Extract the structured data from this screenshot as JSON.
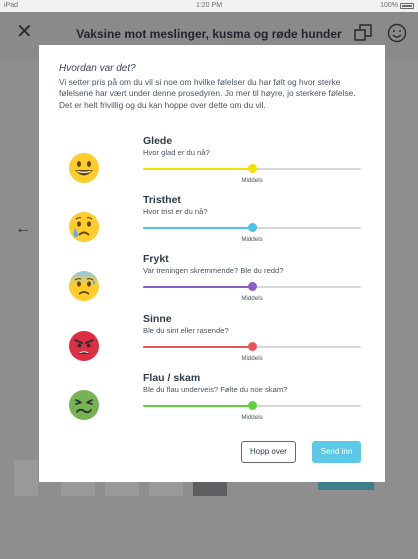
{
  "status_bar": {
    "device": "iPad",
    "time": "1:20 PM",
    "battery": "100%"
  },
  "app": {
    "title": "Vaksine mot meslinger, kusma og røde hunder"
  },
  "modal": {
    "title": "Hvordan var det?",
    "description": "Vi setter pris på om du vil si noe om hvilke følelser du har følt og hvor sterke følelsene har vært under denne prosedyren. Jo mer til høyre, jo sterkere følelse. Det er helt frivillig og du kan hoppe over dette om du vil.",
    "emotions": [
      {
        "name": "Glede",
        "question": "Hvor glad er du nå?",
        "level_label": "Middels",
        "level": 0.5,
        "color": "#f5e100",
        "icon": "grinning-face-icon"
      },
      {
        "name": "Tristhet",
        "question": "Hvor trist er du nå?",
        "level_label": "Middels",
        "level": 0.5,
        "color": "#4cc2e8",
        "icon": "crying-face-icon"
      },
      {
        "name": "Frykt",
        "question": "Var treningen skremmende? Ble du redd?",
        "level_label": "Middels",
        "level": 0.5,
        "color": "#8e5cc6",
        "icon": "anxious-face-icon"
      },
      {
        "name": "Sinne",
        "question": "Ble du sint eller rasende?",
        "level_label": "Middels",
        "level": 0.5,
        "color": "#e85757",
        "icon": "angry-face-icon"
      },
      {
        "name": "Flau / skam",
        "question": "Ble du flau underveis? Følte du noe skam?",
        "level_label": "Middels",
        "level": 0.5,
        "color": "#5cd13b",
        "icon": "nauseated-face-icon"
      }
    ],
    "skip_label": "Hopp over",
    "send_label": "Send inn"
  },
  "colors": {
    "accent": "#5bc8e8",
    "overlay": "#8e8e8e"
  }
}
